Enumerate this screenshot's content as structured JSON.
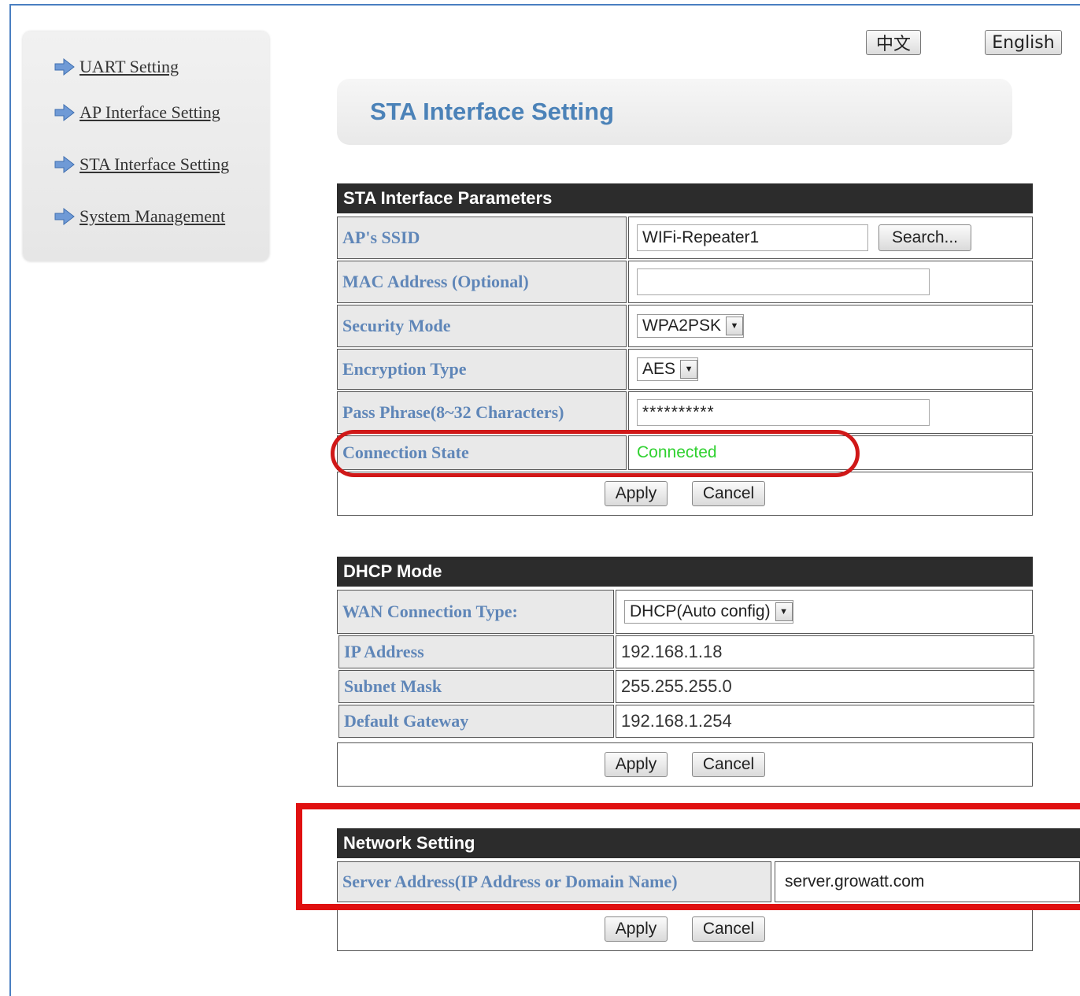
{
  "language": {
    "chinese": "中文",
    "english": "English"
  },
  "sidebar": {
    "items": [
      {
        "label": "UART Setting"
      },
      {
        "label": "AP Interface Setting"
      },
      {
        "label": "STA Interface Setting"
      },
      {
        "label": "System Management"
      }
    ]
  },
  "page": {
    "title": "STA Interface Setting"
  },
  "sta": {
    "header": "STA Interface Parameters",
    "ssid_label": "AP's SSID",
    "ssid_value": "WIFi-Repeater1",
    "search_label": "Search...",
    "mac_label": "MAC Address (Optional)",
    "mac_value": "",
    "security_label": "Security Mode",
    "security_value": "WPA2PSK",
    "encryption_label": "Encryption Type",
    "encryption_value": "AES",
    "pass_label": "Pass Phrase(8~32 Characters)",
    "pass_value": "**********",
    "state_label": "Connection State",
    "state_value": "Connected",
    "state_color": "#2fd12f",
    "apply": "Apply",
    "cancel": "Cancel"
  },
  "dhcp": {
    "header": "DHCP Mode",
    "wan_label": "WAN Connection Type:",
    "wan_value": "DHCP(Auto config)",
    "ip_label": "IP Address",
    "ip_value": "192.168.1.18",
    "mask_label": "Subnet Mask",
    "mask_value": "255.255.255.0",
    "gateway_label": "Default Gateway",
    "gateway_value": "192.168.1.254",
    "apply": "Apply",
    "cancel": "Cancel"
  },
  "network": {
    "header": "Network Setting",
    "server_label": "Server Address(IP Address or Domain Name)",
    "server_value": "server.growatt.com",
    "apply": "Apply",
    "cancel": "Cancel"
  },
  "colors": {
    "accent": "#4b82b8",
    "highlight": "#e01010",
    "header_bg": "#2c2c2c"
  }
}
